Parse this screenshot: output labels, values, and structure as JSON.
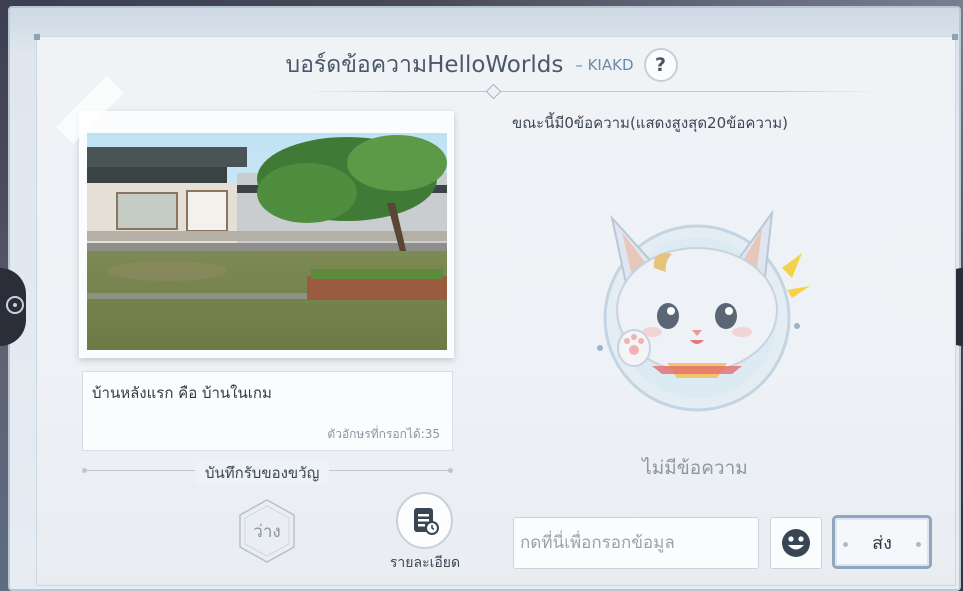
{
  "header": {
    "title": "บอร์ดข้อความHelloWorlds",
    "author": "– KIAKD",
    "help_label": "?"
  },
  "post": {
    "caption": "บ้านหลังแรก คือ บ้านในเกม",
    "char_count": "ตัวอักษรที่กรอกได้:35"
  },
  "gifts": {
    "section_label": "บันทึกรับของขวัญ",
    "empty_slot_label": "ว่าง",
    "detail_label": "รายละเอียด"
  },
  "messages": {
    "count_text": "ขณะนี้มี0ข้อความ(แสดงสูงสุด20ข้อความ)",
    "empty_text": "ไม่มีข้อความ"
  },
  "composer": {
    "placeholder": "กดที่นี่เพื่อกรอกข้อมูล",
    "send_label": "ส่ง"
  },
  "colors": {
    "panel_bg": "#eef1f5",
    "accent": "#8fa6bd",
    "title_text": "#4c5868"
  },
  "icons": {
    "help": "question-icon",
    "detail": "document-clock-icon",
    "emoji": "smiley-icon",
    "empty_slot": "hexagon-frame-icon",
    "mascot": "cat-mascot-illustration"
  }
}
